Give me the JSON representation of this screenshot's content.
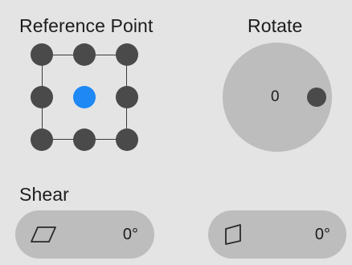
{
  "reference_point": {
    "title": "Reference Point",
    "selected": "center",
    "points": [
      "top-left",
      "top-center",
      "top-right",
      "middle-left",
      "center",
      "middle-right",
      "bottom-left",
      "bottom-center",
      "bottom-right"
    ],
    "colors": {
      "dot": "#4a4a4a",
      "selected": "#1e88f5"
    }
  },
  "rotate": {
    "title": "Rotate",
    "value": "0"
  },
  "shear": {
    "title": "Shear",
    "horizontal": {
      "icon": "parallelogram-horizontal-icon",
      "value": "0°"
    },
    "vertical": {
      "icon": "parallelogram-vertical-icon",
      "value": "0°"
    }
  }
}
